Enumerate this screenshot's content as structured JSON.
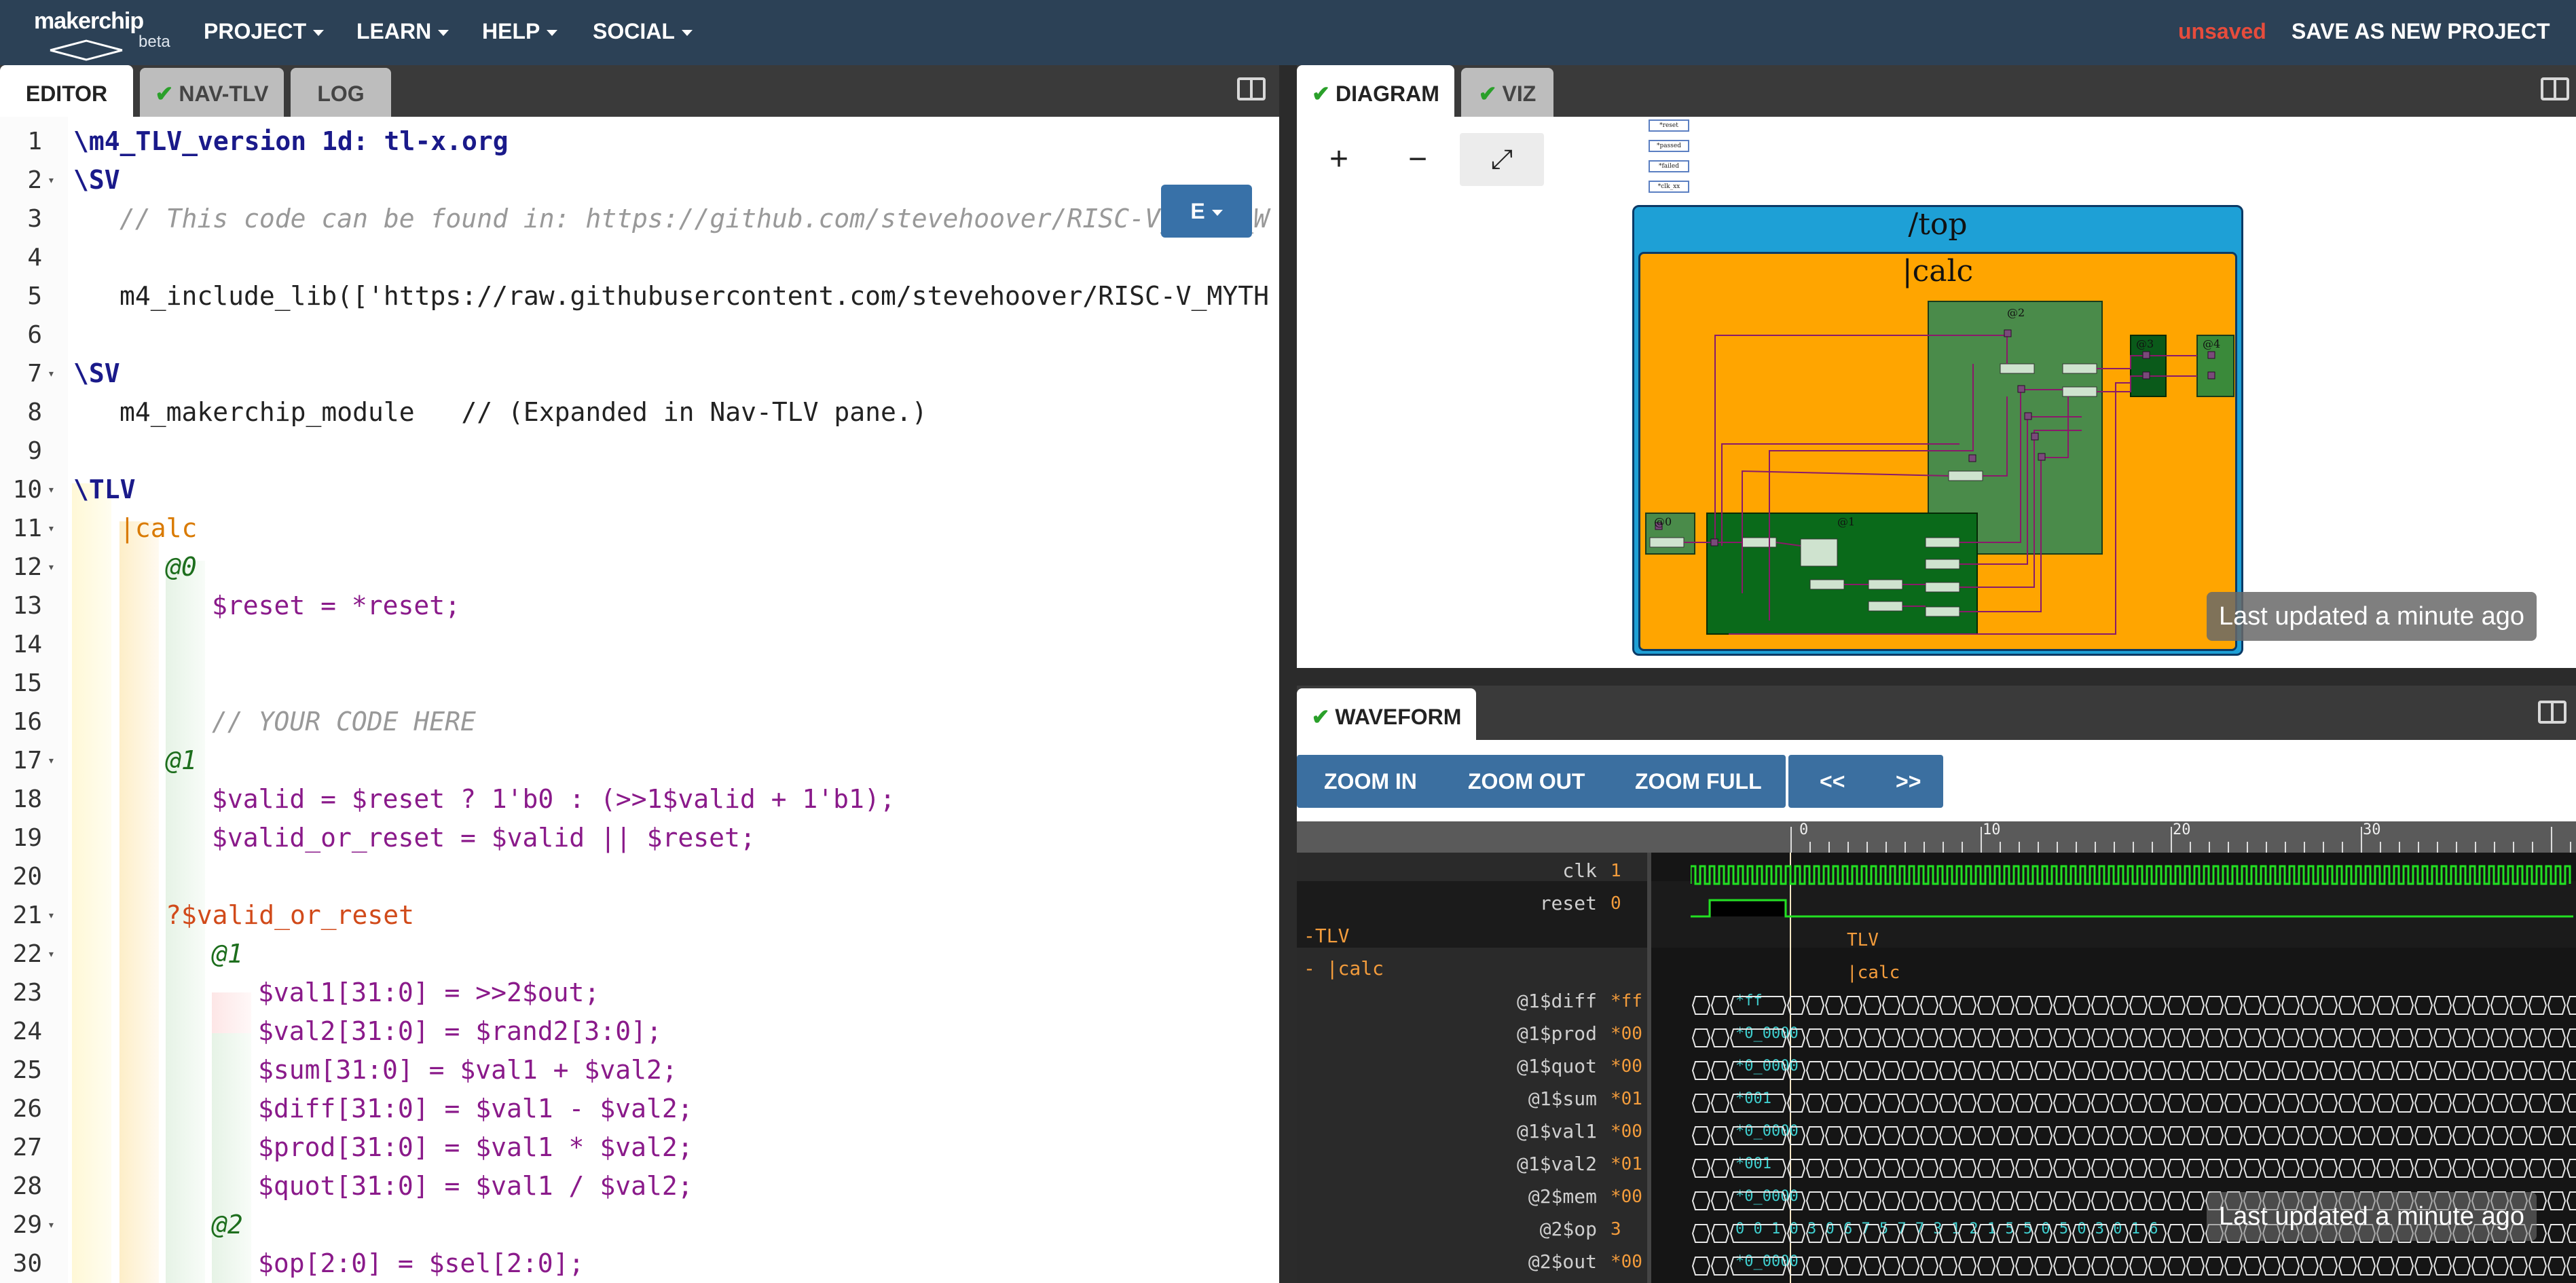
{
  "nav": {
    "logo_text": "makerchip",
    "beta": "beta",
    "menus": [
      "PROJECT",
      "LEARN",
      "HELP",
      "SOCIAL"
    ],
    "unsaved": "unsaved",
    "save_as": "SAVE AS NEW PROJECT"
  },
  "left_tabs": [
    {
      "label": "EDITOR",
      "ok": false
    },
    {
      "label": "NAV-TLV",
      "ok": true
    },
    {
      "label": "LOG",
      "ok": false
    }
  ],
  "editor": {
    "mode_button": "E",
    "lines": [
      {
        "n": "1",
        "fold": false,
        "indent": 0,
        "text": "\\m4_TLV_version 1d: tl-x.org"
      },
      {
        "n": "2",
        "fold": true,
        "indent": 0,
        "text": "\\SV"
      },
      {
        "n": "3",
        "fold": false,
        "indent": 1,
        "text": "// This code can be found in: https://github.com/stevehoover/RISC-V_MYTH_W"
      },
      {
        "n": "4",
        "fold": false,
        "indent": 0,
        "text": ""
      },
      {
        "n": "5",
        "fold": false,
        "indent": 1,
        "text": "m4_include_lib(['https://raw.githubusercontent.com/stevehoover/RISC-V_MYTH"
      },
      {
        "n": "6",
        "fold": false,
        "indent": 0,
        "text": ""
      },
      {
        "n": "7",
        "fold": true,
        "indent": 0,
        "text": "\\SV"
      },
      {
        "n": "8",
        "fold": false,
        "indent": 1,
        "text": "m4_makerchip_module   // (Expanded in Nav-TLV pane.)"
      },
      {
        "n": "9",
        "fold": false,
        "indent": 0,
        "text": ""
      },
      {
        "n": "10",
        "fold": true,
        "indent": 0,
        "text": "\\TLV"
      },
      {
        "n": "11",
        "fold": true,
        "indent": 1,
        "text": "|calc"
      },
      {
        "n": "12",
        "fold": true,
        "indent": 2,
        "text": "@0"
      },
      {
        "n": "13",
        "fold": false,
        "indent": 3,
        "text": "$reset = *reset;"
      },
      {
        "n": "14",
        "fold": false,
        "indent": 0,
        "text": ""
      },
      {
        "n": "15",
        "fold": false,
        "indent": 0,
        "text": ""
      },
      {
        "n": "16",
        "fold": false,
        "indent": 3,
        "text": "// YOUR CODE HERE"
      },
      {
        "n": "17",
        "fold": true,
        "indent": 2,
        "text": "@1"
      },
      {
        "n": "18",
        "fold": false,
        "indent": 3,
        "text": "$valid = $reset ? 1'b0 : (>>1$valid + 1'b1);"
      },
      {
        "n": "19",
        "fold": false,
        "indent": 3,
        "text": "$valid_or_reset = $valid || $reset;"
      },
      {
        "n": "20",
        "fold": false,
        "indent": 0,
        "text": ""
      },
      {
        "n": "21",
        "fold": true,
        "indent": 2,
        "text": "?$valid_or_reset"
      },
      {
        "n": "22",
        "fold": true,
        "indent": 3,
        "text": "@1"
      },
      {
        "n": "23",
        "fold": false,
        "indent": 4,
        "text": "$val1[31:0] = >>2$out;"
      },
      {
        "n": "24",
        "fold": false,
        "indent": 4,
        "text": "$val2[31:0] = $rand2[3:0];"
      },
      {
        "n": "25",
        "fold": false,
        "indent": 4,
        "text": "$sum[31:0] = $val1 + $val2;"
      },
      {
        "n": "26",
        "fold": false,
        "indent": 4,
        "text": "$diff[31:0] = $val1 - $val2;"
      },
      {
        "n": "27",
        "fold": false,
        "indent": 4,
        "text": "$prod[31:0] = $val1 * $val2;"
      },
      {
        "n": "28",
        "fold": false,
        "indent": 4,
        "text": "$quot[31:0] = $val1 / $val2;"
      },
      {
        "n": "29",
        "fold": true,
        "indent": 3,
        "text": "@2"
      },
      {
        "n": "30",
        "fold": false,
        "indent": 4,
        "text": "$op[2:0] = $sel[2:0];"
      }
    ]
  },
  "right_tabs": [
    {
      "label": "DIAGRAM",
      "ok": true
    },
    {
      "label": "VIZ",
      "ok": true
    }
  ],
  "diagram": {
    "zoom_in": "+",
    "zoom_out": "−",
    "fit": "⤢",
    "top_label": "/top",
    "calc_label": "|calc",
    "stages": [
      "@0",
      "@1",
      "@2",
      "@3",
      "@4"
    ],
    "mini_tags": [
      "*reset",
      "*passed",
      "*failed",
      "*clk_xx"
    ],
    "updated": "Last updated a minute ago"
  },
  "waveform": {
    "tab": "WAVEFORM",
    "buttons": [
      "ZOOM IN",
      "ZOOM OUT",
      "ZOOM FULL"
    ],
    "nav": [
      "<<",
      ">>"
    ],
    "ticks": [
      "0",
      "10",
      "20",
      "30"
    ],
    "signals": [
      {
        "name": "clk",
        "val": "1"
      },
      {
        "name": "reset",
        "val": "0"
      },
      {
        "name": "-TLV",
        "val": ""
      },
      {
        "name": "-  |calc",
        "val": ""
      },
      {
        "name": "@1$diff",
        "val": "*ff"
      },
      {
        "name": "@1$prod",
        "val": "*00"
      },
      {
        "name": "@1$quot",
        "val": "*00"
      },
      {
        "name": "@1$sum",
        "val": "*01"
      },
      {
        "name": "@1$val1",
        "val": "*00"
      },
      {
        "name": "@1$val2",
        "val": "*01"
      },
      {
        "name": "@2$mem",
        "val": "*00"
      },
      {
        "name": "@2$op",
        "val": "3"
      },
      {
        "name": "@2$out",
        "val": "*00"
      }
    ],
    "group_labels": [
      "TLV",
      "|calc"
    ],
    "inline_values": [
      "*ff",
      "*0_0000",
      "*0_0000",
      "*001",
      "*0_0000",
      "*001",
      "*0_0000",
      "0 0 1 0 3 0 6 7 5 7 7 3 1 2 1 5 5 0 5 0 3 0 1 6",
      "*0_0000"
    ],
    "updated": "Last updated a minute ago"
  }
}
